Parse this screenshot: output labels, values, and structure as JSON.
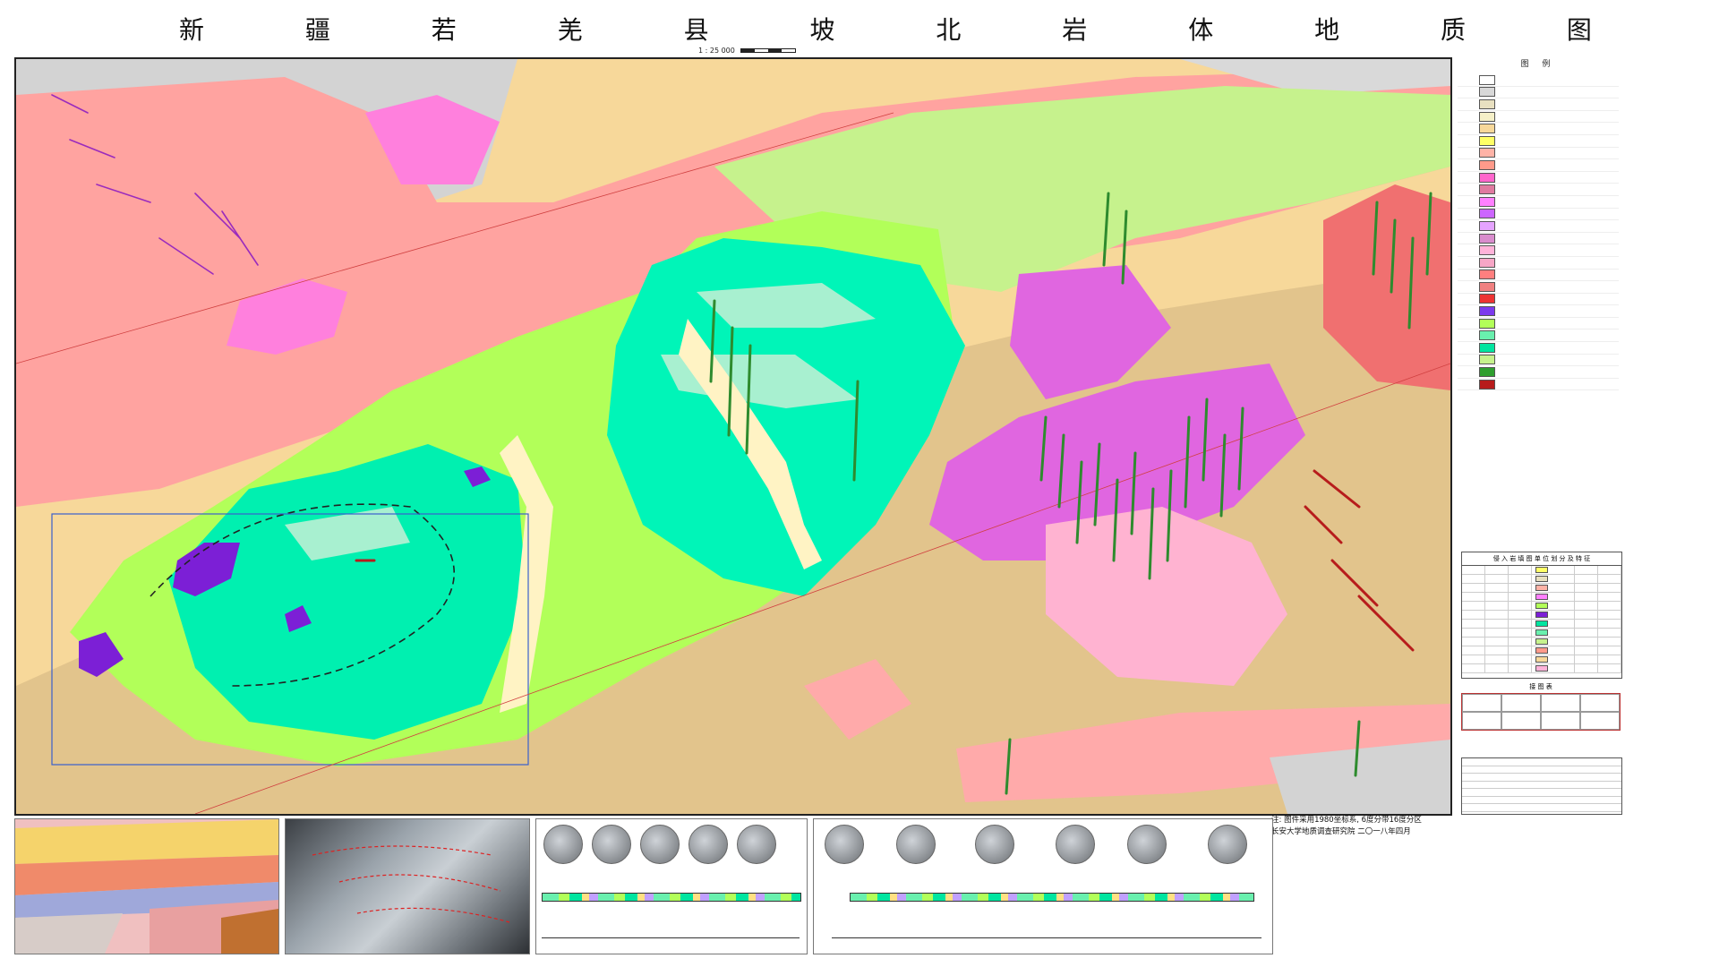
{
  "title": "新 疆 若 羌 县 坡 北 岩 体 地 质 图",
  "scale_text": "1 : 25 000",
  "legend": {
    "title": "图 例",
    "items": [
      {
        "cat": "",
        "label": "",
        "color": "#ffffff"
      },
      {
        "cat": "",
        "label": "",
        "color": "#d8d8d8"
      },
      {
        "cat": "",
        "label": "",
        "color": "#e8e0c0"
      },
      {
        "cat": "",
        "label": "",
        "color": "#f5f0c8"
      },
      {
        "cat": "",
        "label": "",
        "color": "#f7d89a"
      },
      {
        "cat": "",
        "label": "",
        "color": "#ffff66"
      },
      {
        "cat": "",
        "label": "",
        "color": "#ffb3a7"
      },
      {
        "cat": "",
        "label": "",
        "color": "#ff9a8a"
      },
      {
        "cat": "",
        "label": "",
        "color": "#ff66cc"
      },
      {
        "cat": "",
        "label": "",
        "color": "#e07aa0"
      },
      {
        "cat": "",
        "label": "",
        "color": "#ff80ff"
      },
      {
        "cat": "",
        "label": "",
        "color": "#cc66ff"
      },
      {
        "cat": "",
        "label": "",
        "color": "#e5a3ff"
      },
      {
        "cat": "",
        "label": "",
        "color": "#d98ccd"
      },
      {
        "cat": "",
        "label": "",
        "color": "#ffb3d9"
      },
      {
        "cat": "",
        "label": "",
        "color": "#f7a6c6"
      },
      {
        "cat": "",
        "label": "",
        "color": "#ff7f7f"
      },
      {
        "cat": "",
        "label": "",
        "color": "#f08080"
      },
      {
        "cat": "",
        "label": "",
        "color": "#e33"
      },
      {
        "cat": "",
        "label": "",
        "color": "#7c3aed"
      },
      {
        "cat": "",
        "label": "",
        "color": "#b2ff59"
      },
      {
        "cat": "",
        "label": "",
        "color": "#69f0ae"
      },
      {
        "cat": "",
        "label": "",
        "color": "#00e5a0"
      },
      {
        "cat": "",
        "label": "",
        "color": "#c6f28d"
      },
      {
        "cat": "",
        "label": "",
        "color": "#2e9e2e"
      },
      {
        "cat": "",
        "label": "",
        "color": "#b71c1c"
      }
    ]
  },
  "table_title": "侵 入 岩 填 图 单 位 划 分 及 特 征",
  "index_title": "接 图 表",
  "note": "注: 图件采用1980坐标系, 6度分带16度分区",
  "institution": "长安大学地质调查研究院  二〇一八年四月",
  "colors": {
    "quaternary": "#f7d89a",
    "pink_strata": "#ffb3a7",
    "magenta": "#ff66cc",
    "green_intrusion": "#b2ff59",
    "teal_intrusion": "#00f5b8",
    "purple_ultramafic": "#7c1fd6",
    "grey_basement": "#d3d3d3",
    "tan": "#e2c48c",
    "dike_green": "#2e8b2e",
    "dike_red": "#b71c1c"
  }
}
